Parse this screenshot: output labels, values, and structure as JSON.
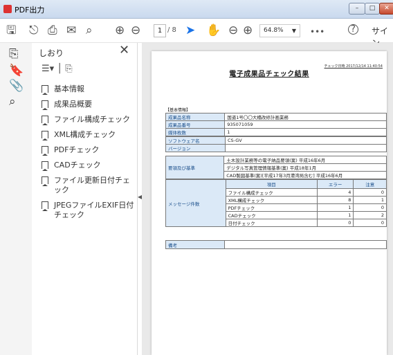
{
  "window": {
    "title": "PDF出力",
    "buttons": {
      "minimize": "–",
      "maximize": "□",
      "close": "✕"
    }
  },
  "toolbar": {
    "page_current": "1",
    "page_total": "/ 8",
    "zoom": "64.8%",
    "more": "•••",
    "sign_label": "サイン",
    "help": "?",
    "icons": [
      "save-icon",
      "share-icon",
      "print-icon",
      "mail-icon",
      "search-icon",
      "page-up-icon",
      "page-down-icon",
      "select-arrow-icon",
      "hand-icon",
      "zoom-out-icon",
      "zoom-in-icon"
    ]
  },
  "sidebar_panel": {
    "title": "しおり",
    "items": [
      "基本情報",
      "成果品概要",
      "ファイル構成チェック",
      "XML構成チェック",
      "PDFチェック",
      "CADチェック",
      "ファイル更新日付チェック",
      "JPEGファイルEXIF日付チェック"
    ]
  },
  "document": {
    "print_date": "チェック日時 2017/12/14 11:40:54",
    "title": "電子成果品チェック結果",
    "section_label": "【基本情報】",
    "basic": [
      {
        "label": "成果品名称",
        "value": "国道1号〇〇大橋改修計画業務"
      },
      {
        "label": "成果品番号",
        "value": "935071059"
      },
      {
        "label": "媒体枚数",
        "value": "1"
      }
    ],
    "software": [
      {
        "label": "ソフトウェア名",
        "value": "CS-GV"
      },
      {
        "label": "バージョン",
        "value": ""
      }
    ],
    "standards_label": "要領及び基準",
    "standards": [
      "土木設計業務等の電子納品要領(案) 平成16年6月",
      "デジタル写真管理情報基準(案) 平成18年1月",
      "CAD製図基準(案)[平成17年3月港湾局含む] 平成16年6月"
    ],
    "messages_label": "メッセージ件数",
    "messages_headers": [
      "項目",
      "エラー",
      "注意"
    ],
    "messages": [
      {
        "item": "ファイル構成チェック",
        "error": "4",
        "warning": "0"
      },
      {
        "item": "XML構成チェック",
        "error": "8",
        "warning": "1"
      },
      {
        "item": "PDFチェック",
        "error": "1",
        "warning": "0"
      },
      {
        "item": "CADチェック",
        "error": "1",
        "warning": "2"
      },
      {
        "item": "日付チェック",
        "error": "0",
        "warning": "0"
      }
    ],
    "remarks_label": "備考",
    "remarks_value": ""
  }
}
